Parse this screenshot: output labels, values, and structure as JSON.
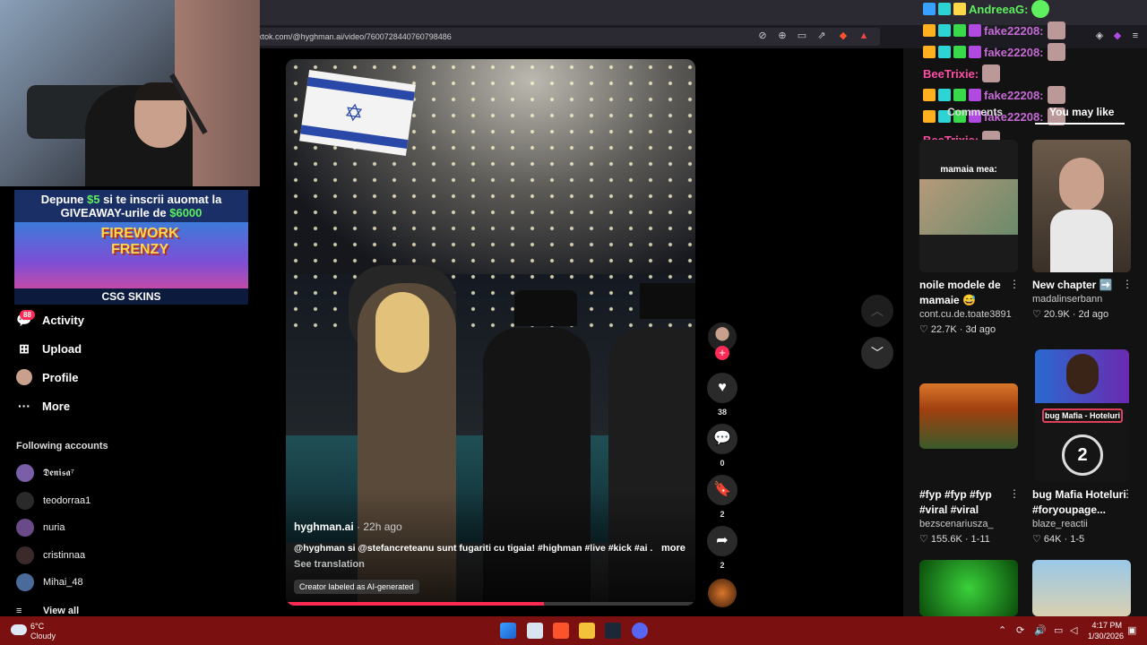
{
  "browser": {
    "url": "ktok.com/@hyghman.ai/video/7600728440760798486"
  },
  "promo": {
    "line1_pre": "Depune ",
    "line1_amount": "$5",
    "line1_post": " si te inscrii auomat la",
    "line2_pre": "GIVEAWAY-urile de ",
    "line2_amount": "$6000",
    "art_title": "FIREWORK FRENZY",
    "footer": "CSG SKINS"
  },
  "sidebar": {
    "activity_badge": "88",
    "items": [
      {
        "label": "Activity",
        "icon": "message-icon"
      },
      {
        "label": "Upload",
        "icon": "plus-square-icon"
      },
      {
        "label": "Profile",
        "icon": "avatar-icon"
      },
      {
        "label": "More",
        "icon": "more-dots-icon"
      }
    ],
    "following_header": "Following accounts",
    "following": [
      {
        "name": "𝕯𝖊𝖓𝖎𝖘𝖆⁷",
        "color": "#7b5ea8"
      },
      {
        "name": "teodorraa1",
        "color": "#2a2a2a"
      },
      {
        "name": "nuria",
        "color": "#6b4a8a"
      },
      {
        "name": "cristinnaa",
        "color": "#3a2a2a"
      },
      {
        "name": "Mihai_48",
        "color": "#4a6a9a"
      }
    ],
    "view_all": "View all"
  },
  "video": {
    "author": "hyghman.ai",
    "time": " · 22h ago",
    "caption": "@hyghman si @stefancreteanu sunt fugariti cu tigaia! #highman #live #kick #ai ...",
    "more": "more",
    "see_translation": "See translation",
    "ai_label": "Creator labeled as AI-generated",
    "progress": 0.63
  },
  "actions": {
    "likes": "38",
    "comments": "0",
    "saves": "2",
    "shares": "2"
  },
  "chat": [
    {
      "user": "AndreeaG:",
      "color": "#5ef05e"
    },
    {
      "user": "fake22208:",
      "color": "#c66ad6"
    },
    {
      "user": "fake22208:",
      "color": "#c66ad6"
    },
    {
      "user": "BeeTrixie:",
      "color": "#ff4da6"
    },
    {
      "user": "fake22208:",
      "color": "#c66ad6"
    },
    {
      "user": "fake22208:",
      "color": "#c66ad6"
    },
    {
      "user": "BeeTrixie:",
      "color": "#ff4da6"
    }
  ],
  "panel": {
    "tab_comments": "Comments",
    "tab_you_may_like": "You may like",
    "cards": [
      {
        "thumb_text": "mamaia mea:",
        "title": "noile modele de mamaie 😅",
        "user": "cont.cu.de.toate3891",
        "likes": "♡ 22.7K",
        "age": " · 3d ago"
      },
      {
        "thumb_text": "",
        "title": "New chapter ➡️",
        "user": "madalinserbann",
        "likes": "♡ 20.9K",
        "age": " · 2d ago"
      },
      {
        "thumb_text": "",
        "title": "#fyp #fyp #fyp #viral #viral",
        "user": "bezscenariusza_",
        "likes": "♡ 155.6K",
        "age": " · 1-11"
      },
      {
        "thumb_text": "bug Mafia - Hoteluri",
        "title": "bug Mafia Hoteluri #foryoupage...",
        "user": "blaze_reactii",
        "likes": "♡ 64K",
        "age": " · 1-5"
      }
    ]
  },
  "taskbar": {
    "temp": "6°C",
    "weather": "Cloudy",
    "time": "4:17 PM",
    "date": "1/30/2026"
  }
}
